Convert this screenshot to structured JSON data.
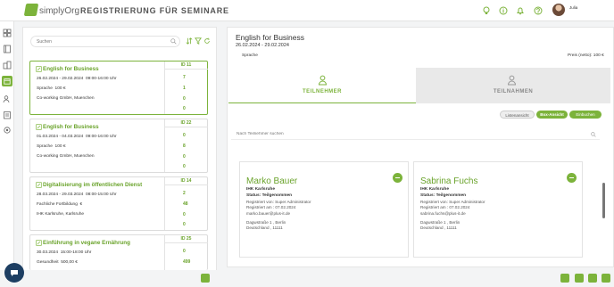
{
  "header": {
    "logo_text": "simplyOrg",
    "title": "REGISTRIERUNG FÜR SEMINARE",
    "username": "Julia"
  },
  "search": {
    "placeholder": "Suchen"
  },
  "courses": [
    {
      "title": "English for Business",
      "id": "ID 11",
      "date": "26.02.2024 - 29.02.2024",
      "time": "09:00-16:00 Uhr",
      "category": "Sprache",
      "price": "100 €",
      "location": "Co-working GmbH, Muenchen",
      "stats": [
        "7",
        "1",
        "0",
        "0"
      ]
    },
    {
      "title": "English for Business",
      "id": "ID 22",
      "date": "01.03.2024 - 04.03.2024",
      "time": "09:00-16:00 Uhr",
      "category": "Sprache",
      "price": "100 €",
      "location": "Co-working GmbH, Muenchen",
      "stats": [
        "0",
        "8",
        "0",
        "0"
      ]
    },
    {
      "title": "Digitalisierung im öffentlichen Dienst",
      "id": "ID 14",
      "date": "28.03.2024 - 29.03.2024",
      "time": "08:00-15:00 Uhr",
      "category": "Fachliche Fortbildung",
      "price": "€",
      "location": "IHK Karlsruhe, Karlsruhe",
      "stats": [
        "2",
        "48",
        "0",
        "0"
      ]
    },
    {
      "title": "Einführung in vegane Ernährung",
      "id": "ID 25",
      "date": "30.03.2024",
      "time": "15:00-18:00 Uhr",
      "category": "Gesundheit",
      "price": "500,00 €",
      "location": "",
      "stats": [
        "0",
        "499"
      ]
    }
  ],
  "detail": {
    "title": "English for Business",
    "dates": "26.02.2024 - 29.02.2024",
    "category": "Sprache",
    "price": "Preis (netto): 100 €",
    "tabs": [
      {
        "label": "TEILNEHMER",
        "active": true
      },
      {
        "label": "TEILNAHMEN",
        "active": false
      }
    ],
    "view_buttons": [
      "Listenansicht",
      "Box-Ansicht",
      "Einbuchen"
    ],
    "participant_search_placeholder": "Nach Teilnehmer suchen",
    "participants": [
      {
        "name": "Marko Bauer",
        "company": "IHK Karlsruhe",
        "status": "Status: Teilgenommen",
        "registered_by": "Registriert von: Super Administrator",
        "registered_on": "Registriert am : 07.02.2024",
        "email": "marko.bauer@plus-it.de",
        "street": "Dagwstraße 1 , Berlin",
        "country": "Deutschland , 11111"
      },
      {
        "name": "Sabrina Fuchs",
        "company": "IHK Karlsruhe",
        "status": "Status: Teilgenommen",
        "registered_by": "Registriert von: Super Administrator",
        "registered_on": "Registriert am : 07.02.2024",
        "email": "sabrina.fuchs@plus-it.de",
        "street": "Dagwstraße 1 , Berlin",
        "country": "Deutschland , 11111"
      }
    ]
  },
  "colors": {
    "accent": "#7cb33b",
    "accent_dark": "#6aa32b",
    "chat": "#1d3e62"
  }
}
